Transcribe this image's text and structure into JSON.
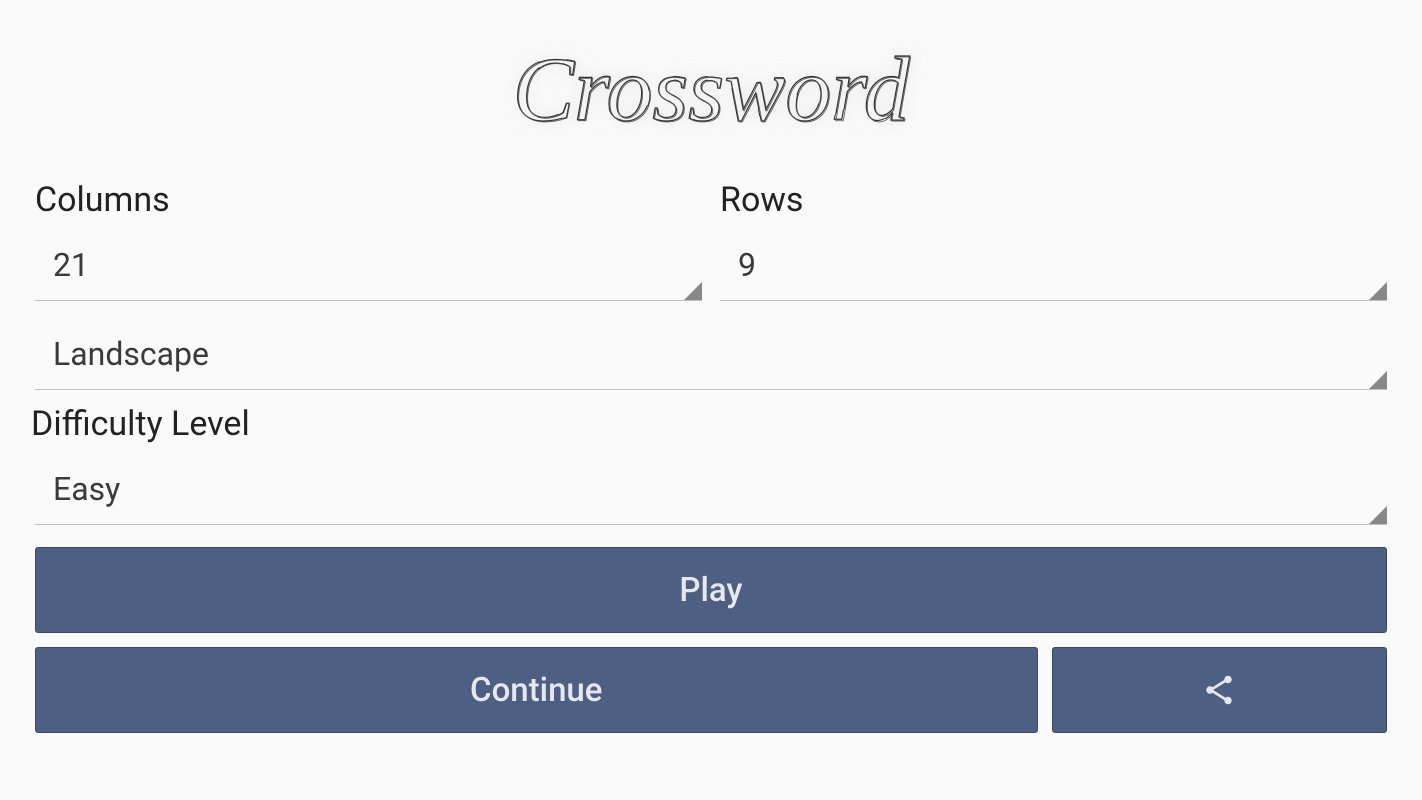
{
  "title": "Crossword",
  "fields": {
    "columns": {
      "label": "Columns",
      "value": "21"
    },
    "rows": {
      "label": "Rows",
      "value": "9"
    },
    "orientation": {
      "value": "Landscape"
    },
    "difficulty": {
      "label": "Difficulty Level",
      "value": "Easy"
    }
  },
  "buttons": {
    "play": "Play",
    "continue": "Continue"
  },
  "icons": {
    "share": "share-icon"
  },
  "colors": {
    "button_bg": "#4d5f82",
    "button_text": "#e6e8ef",
    "background": "#fafafa"
  }
}
